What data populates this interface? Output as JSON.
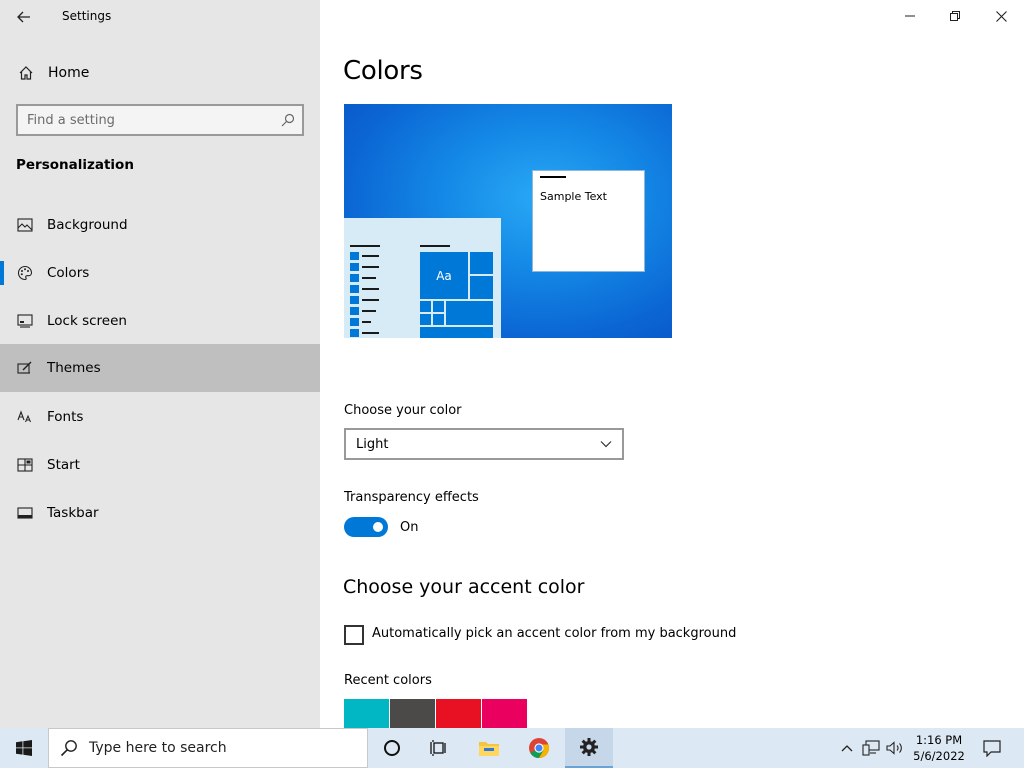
{
  "window": {
    "app_title": "Settings",
    "controls": [
      "minimize",
      "restore",
      "close"
    ]
  },
  "sidebar": {
    "home_label": "Home",
    "search_placeholder": "Find a setting",
    "section_title": "Personalization",
    "items": [
      {
        "label": "Background",
        "icon": "picture-icon"
      },
      {
        "label": "Colors",
        "icon": "palette-icon",
        "selected": true
      },
      {
        "label": "Lock screen",
        "icon": "lock-screen-icon"
      },
      {
        "label": "Themes",
        "icon": "brush-icon",
        "hover": true
      },
      {
        "label": "Fonts",
        "icon": "font-icon"
      },
      {
        "label": "Start",
        "icon": "start-tiles-icon"
      },
      {
        "label": "Taskbar",
        "icon": "taskbar-icon"
      }
    ]
  },
  "main": {
    "title": "Colors",
    "preview": {
      "sample_text": "Sample Text",
      "tile_label": "Aa"
    },
    "choose_color_label": "Choose your color",
    "choose_color_value": "Light",
    "transparency_label": "Transparency effects",
    "transparency_state": "On",
    "accent_heading": "Choose your accent color",
    "auto_pick_label": "Automatically pick an accent color from my background",
    "auto_pick_checked": false,
    "recent_colors_label": "Recent colors",
    "recent_colors": [
      "#00b7c3",
      "#4c4a48",
      "#e81123",
      "#ea005e"
    ]
  },
  "taskbar": {
    "search_placeholder": "Type here to search",
    "pinned": [
      "cortana-icon",
      "task-view-icon",
      "file-explorer-icon",
      "chrome-icon",
      "settings-icon"
    ],
    "time": "1:16 PM",
    "date": "5/6/2022"
  },
  "colors": {
    "accent": "#0078d7",
    "sidebar_bg": "#e6e6e6",
    "hover_bg": "#bfbfbf",
    "taskbar_bg": "#dce9f4"
  }
}
